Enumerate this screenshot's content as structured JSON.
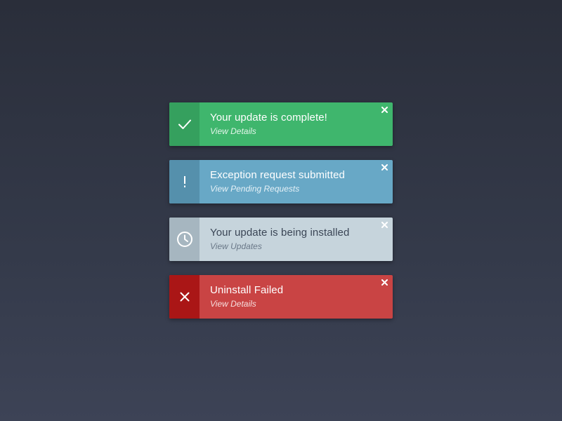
{
  "notifications": [
    {
      "type": "success",
      "icon": "check-icon",
      "title": "Your update is complete!",
      "link": "View Details",
      "close": "×",
      "color": "#3fb66d"
    },
    {
      "type": "info",
      "icon": "exclamation-icon",
      "title": "Exception request submitted",
      "link": "View Pending Requests",
      "close": "×",
      "color": "#68a8c6"
    },
    {
      "type": "progress",
      "icon": "clock-icon",
      "title": "Your update is being installed",
      "link": "View Updates",
      "close": "×",
      "color": "#c6d4dc"
    },
    {
      "type": "error",
      "icon": "x-icon",
      "title": "Uninstall Failed",
      "link": "View Details",
      "close": "×",
      "color": "#c94444"
    }
  ]
}
